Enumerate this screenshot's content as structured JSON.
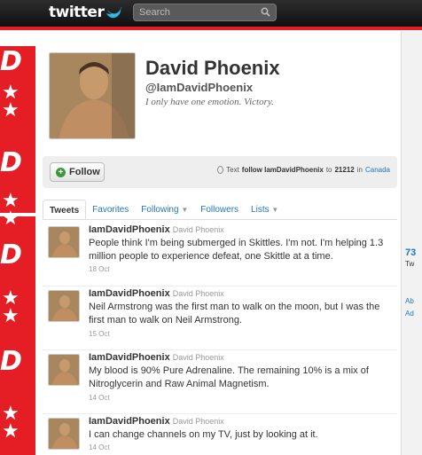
{
  "header": {
    "logo_text": "twitter",
    "search_placeholder": "Search"
  },
  "profile": {
    "name": "David Phoenix",
    "handle": "@IamDavidPhoenix",
    "bio": "I only have one emotion. Victory."
  },
  "actions": {
    "follow_label": "Follow",
    "sms_prefix": "Text",
    "sms_command": "follow IamDavidPhoenix",
    "sms_to": "to",
    "sms_number": "21212",
    "sms_in": "in",
    "sms_country": "Canada"
  },
  "tabs": [
    {
      "label": "Tweets"
    },
    {
      "label": "Favorites"
    },
    {
      "label": "Following"
    },
    {
      "label": "Followers"
    },
    {
      "label": "Lists"
    }
  ],
  "tweets": [
    {
      "user": "IamDavidPhoenix",
      "name": "David Phoenix",
      "text": "People think I'm being submerged in Skittles. I'm not. I'm helping 1.3 million people to experience defeat, one Skittle at a time.",
      "time": "18 Oct"
    },
    {
      "user": "IamDavidPhoenix",
      "name": "David Phoenix",
      "text": "Neil Armstrong was the first man to walk on the moon, but I was the first man to walk on Neil Armstrong.",
      "time": "15 Oct"
    },
    {
      "user": "IamDavidPhoenix",
      "name": "David Phoenix",
      "text": "My blood is 90% Pure Adrenaline. The remaining 10% is a mix of Nitroglycerin and Raw Animal Magnetism.",
      "time": "14 Oct"
    },
    {
      "user": "IamDavidPhoenix",
      "name": "David Phoenix",
      "text": "I can change channels on my TV, just by looking at it.",
      "time": "14 Oct"
    }
  ],
  "sidebar_cut": {
    "stat": "73",
    "line1": "Tw",
    "line2": "Ab",
    "line3": "Ad"
  },
  "colors": {
    "background_red": "#e51d24",
    "link_blue": "#2276bb",
    "topbar": "#1a1a1a"
  }
}
